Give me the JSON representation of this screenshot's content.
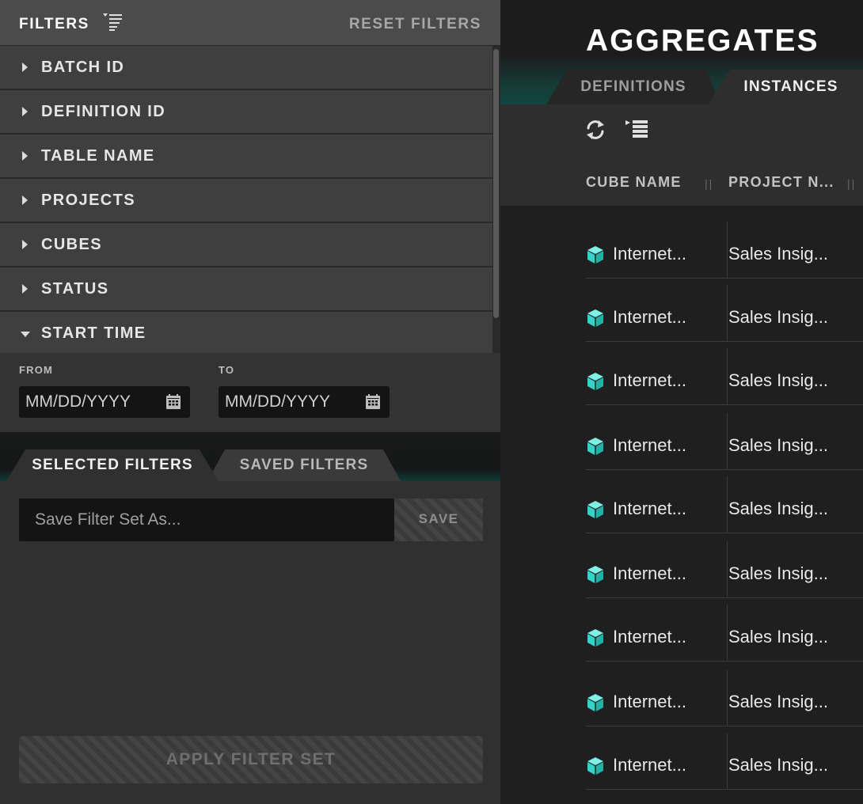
{
  "filters": {
    "title": "FILTERS",
    "reset_label": "RESET FILTERS",
    "items": [
      {
        "label": "BATCH ID",
        "expanded": false
      },
      {
        "label": "DEFINITION ID",
        "expanded": false
      },
      {
        "label": "TABLE NAME",
        "expanded": false
      },
      {
        "label": "PROJECTS",
        "expanded": false
      },
      {
        "label": "CUBES",
        "expanded": false
      },
      {
        "label": "STATUS",
        "expanded": false
      },
      {
        "label": "START TIME",
        "expanded": true
      }
    ],
    "start_time": {
      "from_label": "FROM",
      "to_label": "TO",
      "from_placeholder": "MM/DD/YYYY",
      "to_placeholder": "MM/DD/YYYY"
    },
    "tabs": {
      "selected": "SELECTED FILTERS",
      "saved": "SAVED FILTERS"
    },
    "save_placeholder": "Save Filter Set As...",
    "save_label": "SAVE",
    "apply_label": "APPLY FILTER SET"
  },
  "aggregates": {
    "title": "AGGREGATES",
    "tabs": {
      "definitions": "DEFINITIONS",
      "instances": "INSTANCES"
    },
    "columns": {
      "cube_name": "CUBE NAME",
      "project_name": "PROJECT N..."
    },
    "rows": [
      {
        "cube": "Internet...",
        "project": "Sales Insig..."
      },
      {
        "cube": "Internet...",
        "project": "Sales Insig..."
      },
      {
        "cube": "Internet...",
        "project": "Sales Insig..."
      },
      {
        "cube": "Internet...",
        "project": "Sales Insig..."
      },
      {
        "cube": "Internet...",
        "project": "Sales Insig..."
      },
      {
        "cube": "Internet...",
        "project": "Sales Insig..."
      },
      {
        "cube": "Internet...",
        "project": "Sales Insig..."
      },
      {
        "cube": "Internet...",
        "project": "Sales Insig..."
      },
      {
        "cube": "Internet...",
        "project": "Sales Insig..."
      }
    ]
  },
  "icons": {
    "filter": "filter-list-icon",
    "caret_right": "caret-right-icon",
    "caret_down": "caret-down-icon",
    "calendar": "calendar-icon",
    "collapse": "chevron-left-icon",
    "refresh": "refresh-icon",
    "columns": "column-chooser-icon",
    "cube": "cube-icon"
  },
  "colors": {
    "accent": "#2fd6c8",
    "panel": "#303030",
    "header": "#4b4b4b"
  }
}
